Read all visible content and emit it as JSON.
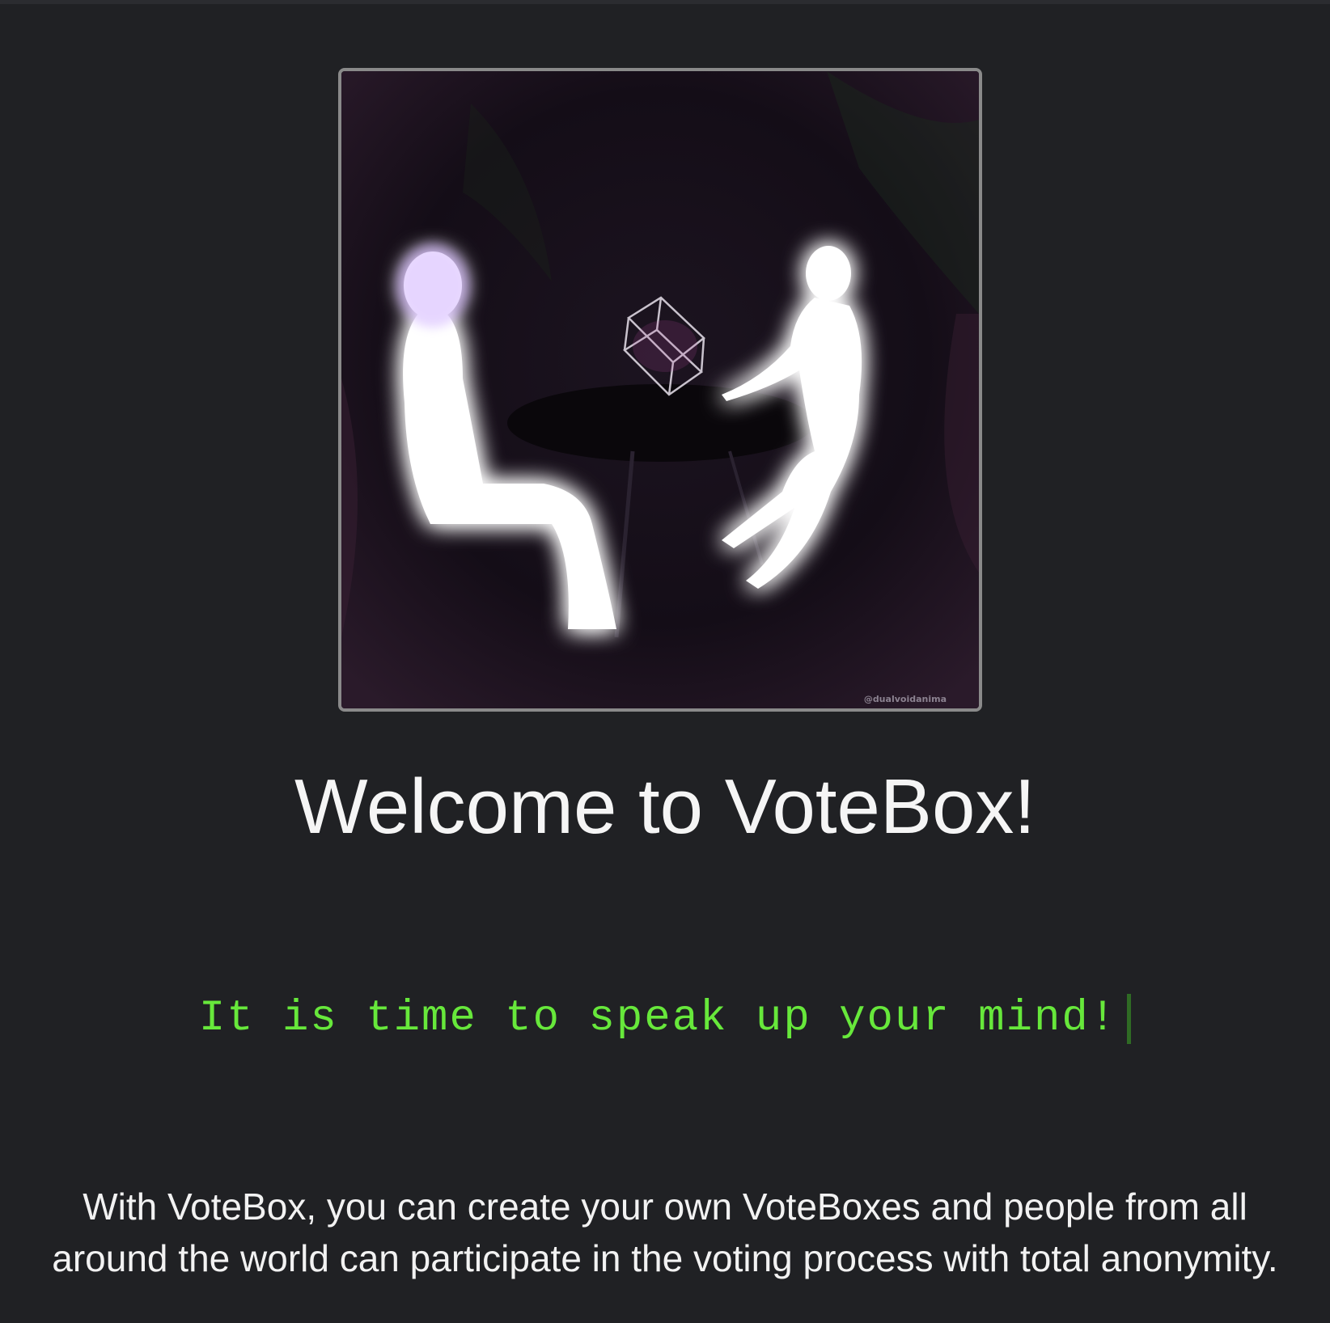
{
  "hero": {
    "image_icon": "two-glowing-figures-with-cube-illustration",
    "watermark": "@dualvoidanima"
  },
  "welcome": {
    "title": "Welcome to VoteBox!"
  },
  "tagline": {
    "text": "It is time to speak up your mind!"
  },
  "intro": {
    "line1": "With VoteBox, you can create your own VoteBoxes and people from all",
    "line2": "around the world can participate in the voting process with total anonymity."
  },
  "colors": {
    "background": "#202124",
    "tagline": "#67e83b",
    "caret": "#2f6b24",
    "frame_border": "#8a8a8a",
    "glow": "#b98aff"
  }
}
